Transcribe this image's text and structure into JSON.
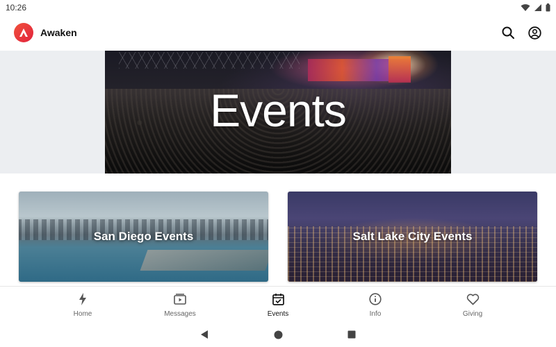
{
  "status_bar": {
    "time": "10:26"
  },
  "app_bar": {
    "title": "Awaken"
  },
  "hero": {
    "title": "Events"
  },
  "cards": [
    {
      "label": "San Diego Events"
    },
    {
      "label": "Salt Lake City Events"
    }
  ],
  "bottom_nav": {
    "items": [
      {
        "label": "Home",
        "icon": "lightning-icon"
      },
      {
        "label": "Messages",
        "icon": "video-icon"
      },
      {
        "label": "Events",
        "icon": "calendar-icon",
        "active": true
      },
      {
        "label": "Info",
        "icon": "info-icon"
      },
      {
        "label": "Giving",
        "icon": "heart-icon"
      }
    ]
  },
  "colors": {
    "brand": "#e63a3a",
    "active": "#111111",
    "inactive": "#666666"
  }
}
